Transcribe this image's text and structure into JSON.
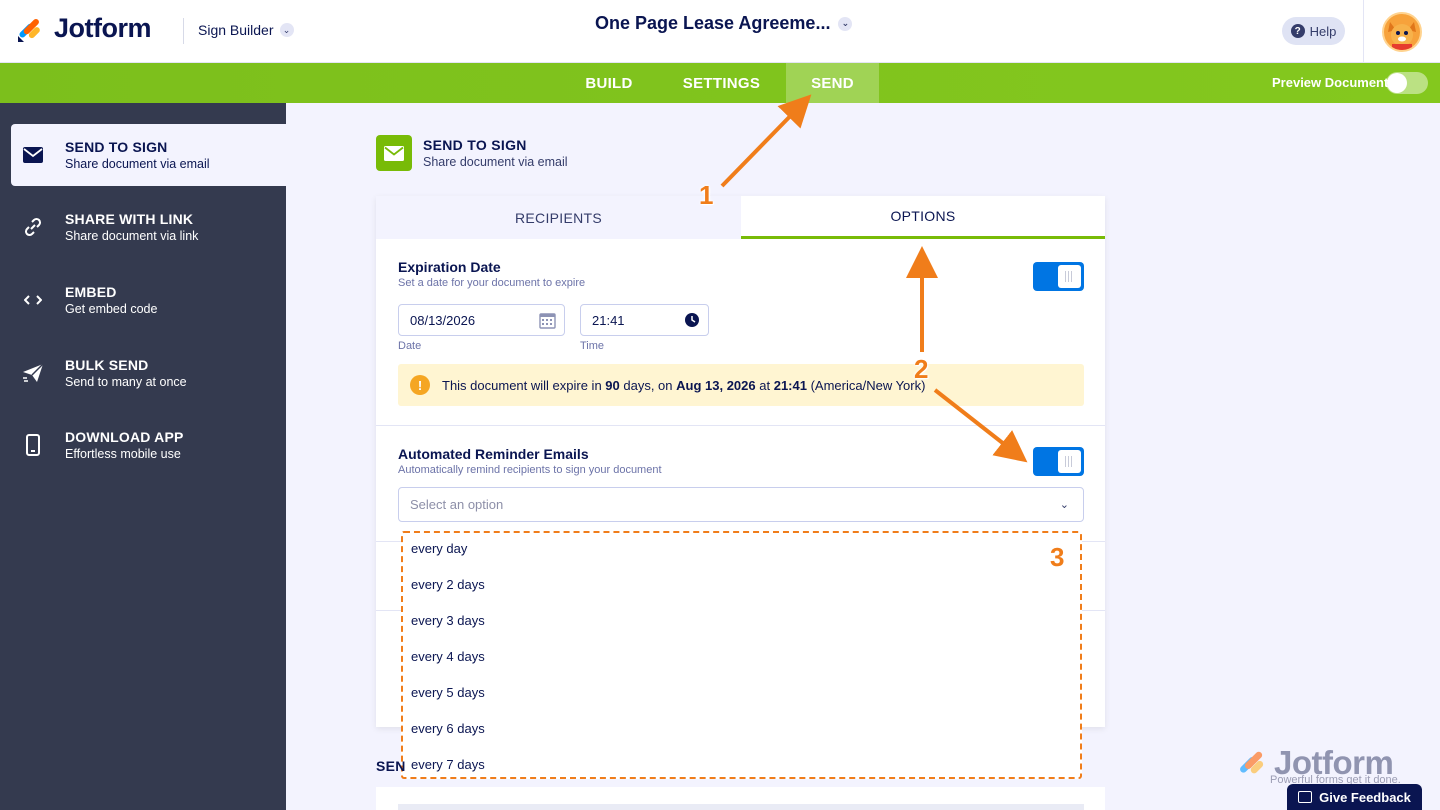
{
  "app": {
    "brand": "Jotform",
    "product_menu": "Sign Builder",
    "document_title": "One Page Lease Agreeme...",
    "help_label": "Help"
  },
  "nav": {
    "tabs": [
      {
        "label": "BUILD",
        "active": false
      },
      {
        "label": "SETTINGS",
        "active": false
      },
      {
        "label": "SEND",
        "active": true
      }
    ],
    "preview_label": "Preview Document",
    "preview_on": false
  },
  "sidebar": {
    "items": [
      {
        "title": "SEND TO SIGN",
        "subtitle": "Share document via email",
        "icon": "envelope-icon",
        "active": true
      },
      {
        "title": "SHARE WITH LINK",
        "subtitle": "Share document via link",
        "icon": "link-icon",
        "active": false
      },
      {
        "title": "EMBED",
        "subtitle": "Get embed code",
        "icon": "code-icon",
        "active": false
      },
      {
        "title": "BULK SEND",
        "subtitle": "Send to many at once",
        "icon": "paper-plane-icon",
        "active": false
      },
      {
        "title": "DOWNLOAD APP",
        "subtitle": "Effortless mobile use",
        "icon": "phone-icon",
        "active": false
      }
    ]
  },
  "main": {
    "title": "SEND TO SIGN",
    "subtitle": "Share document via email",
    "tabs": [
      {
        "label": "RECIPIENTS",
        "active": false
      },
      {
        "label": "OPTIONS",
        "active": true
      }
    ],
    "expiration": {
      "title": "Expiration Date",
      "subtitle": "Set a date for your document to expire",
      "enabled": true,
      "date_value": "08/13/2026",
      "date_label": "Date",
      "time_value": "21:41",
      "time_label": "Time",
      "notice": {
        "prefix": "This document will expire in ",
        "days": "90",
        "mid1": " days, on ",
        "date": "Aug 13, 2026",
        "mid2": " at ",
        "time": "21:41",
        "suffix": " (America/New York)"
      }
    },
    "reminder": {
      "title": "Automated Reminder Emails",
      "subtitle": "Automatically remind recipients to sign your document",
      "enabled": true,
      "select_placeholder": "Select an option",
      "options": [
        "every day",
        "every 2 days",
        "every 3 days",
        "every 4 days",
        "every 5 days",
        "every 6 days",
        "every 7 days"
      ]
    },
    "bottom_partial_label": "SEN"
  },
  "annotations": {
    "numbers": [
      "1",
      "2",
      "3"
    ],
    "color": "#f07d1a"
  },
  "watermark": {
    "brand": "Jotform",
    "tagline": "Powerful forms get it done."
  },
  "feedback_label": "Give Feedback",
  "colors": {
    "green": "#7cbf1c",
    "navy": "#0a1551",
    "sidebar": "#343a4f",
    "toggle": "#0075e3",
    "orange": "#f07d1a"
  }
}
